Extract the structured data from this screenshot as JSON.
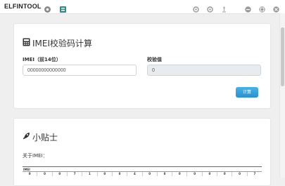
{
  "app": {
    "brand": "ELFINTOOL",
    "colors": {
      "accent": "#2d97d6",
      "page_bg": "#efefef",
      "readonly_bg": "#e9ecef"
    },
    "toolbar_icons": [
      "gear-icon",
      "app-grid-icon"
    ],
    "right_icons": [
      "settings-icon",
      "refresh-icon",
      "pin-icon",
      "minimize-icon",
      "restore-icon",
      "close-icon"
    ]
  },
  "calculator": {
    "title": "IMEI校验码计算",
    "title_icon": "calculator-icon",
    "imei_label": "IMEI（前14位）",
    "imei_value": "00000000000000",
    "check_label": "校验值",
    "check_value": "0",
    "button_label": "计算"
  },
  "tips": {
    "title": "小贴士",
    "title_icon": "rocket-icon",
    "about": "关于IMEI：",
    "table_header": "IMEI",
    "table_digits": [
      "0",
      "0",
      "0",
      "7",
      "1",
      "0",
      "0",
      "4",
      "0",
      "0",
      "0",
      "0",
      "0",
      "0",
      "0",
      "7"
    ]
  }
}
